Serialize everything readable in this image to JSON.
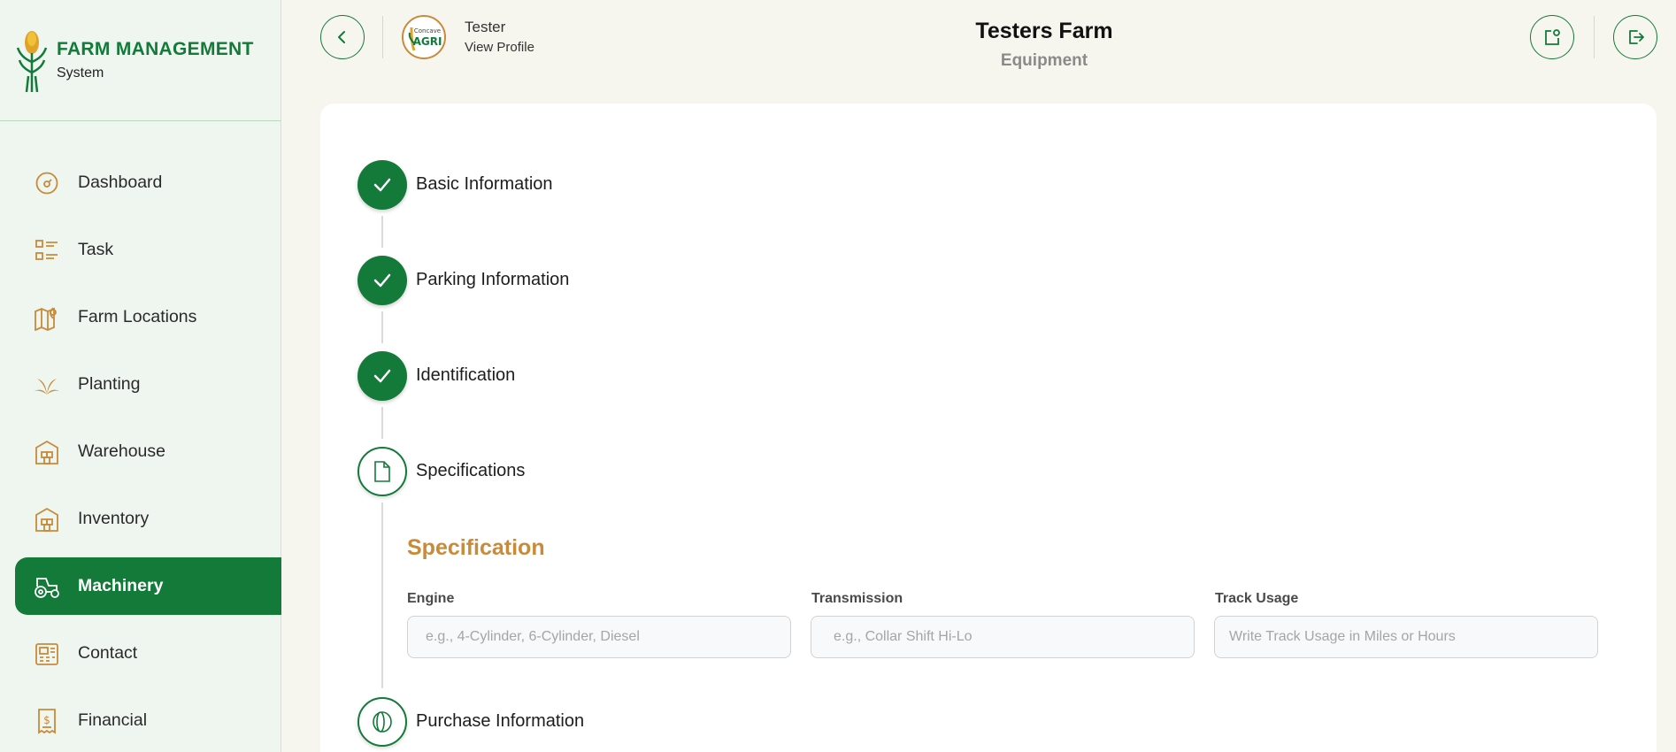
{
  "brand": {
    "title": "FARM MANAGEMENT",
    "subtitle": "System"
  },
  "sidebar": {
    "items": [
      {
        "label": "Dashboard",
        "icon": "dashboard-icon"
      },
      {
        "label": "Task",
        "icon": "task-list-icon"
      },
      {
        "label": "Farm Locations",
        "icon": "map-pin-icon"
      },
      {
        "label": "Planting",
        "icon": "plant-icon"
      },
      {
        "label": "Warehouse",
        "icon": "warehouse-icon"
      },
      {
        "label": "Inventory",
        "icon": "inventory-icon"
      },
      {
        "label": "Machinery",
        "icon": "tractor-icon",
        "active": true
      },
      {
        "label": "Contact",
        "icon": "contact-book-icon"
      },
      {
        "label": "Financial",
        "icon": "receipt-dollar-icon"
      }
    ]
  },
  "header": {
    "user_name": "Tester",
    "view_profile": "View Profile",
    "avatar_text_top": "Concave",
    "avatar_text_bottom": "AGRI",
    "farm_name": "Testers Farm",
    "page": "Equipment"
  },
  "steps": [
    {
      "label": "Basic Information",
      "status": "done"
    },
    {
      "label": "Parking Information",
      "status": "done"
    },
    {
      "label": "Identification",
      "status": "done"
    },
    {
      "label": "Specifications",
      "status": "current"
    },
    {
      "label": "Purchase Information",
      "status": "upcoming"
    }
  ],
  "specification": {
    "title": "Specification",
    "engine": {
      "label": "Engine",
      "placeholder": "e.g., 4-Cylinder, 6-Cylinder, Diesel",
      "value": ""
    },
    "transmission": {
      "label": "Transmission",
      "placeholder": "e.g., Collar Shift Hi-Lo",
      "value": ""
    },
    "track_usage": {
      "label": "Track Usage",
      "placeholder": "Write Track Usage in Miles or Hours",
      "value": ""
    }
  },
  "colors": {
    "primary": "#137a3a",
    "accent": "#c98a3a",
    "sidebar_bg": "#eef6ef",
    "page_bg": "#f7f6ee"
  }
}
